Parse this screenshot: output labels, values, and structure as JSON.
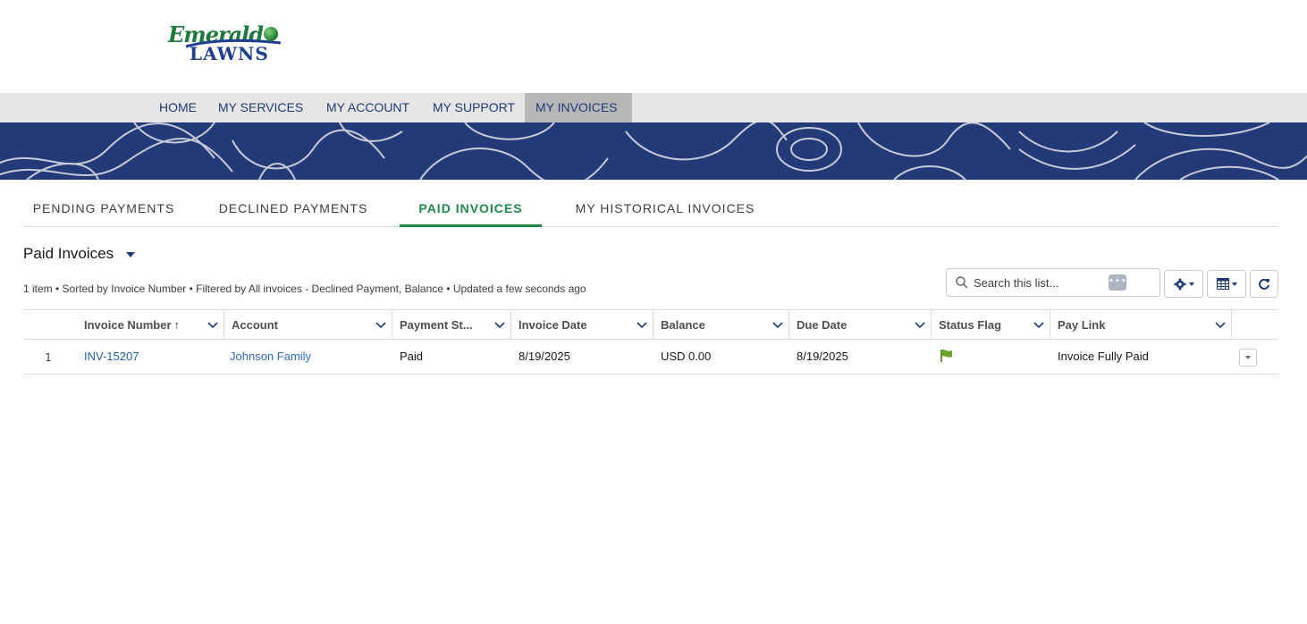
{
  "logo": {
    "script_text": "Emerald",
    "block_text": "LAWNS"
  },
  "nav": {
    "items": [
      {
        "label": "HOME"
      },
      {
        "label": "MY SERVICES"
      },
      {
        "label": "MY ACCOUNT"
      },
      {
        "label": "MY SUPPORT"
      },
      {
        "label": "MY INVOICES",
        "active": true
      }
    ]
  },
  "tabs": [
    {
      "label": "PENDING PAYMENTS"
    },
    {
      "label": "DECLINED PAYMENTS"
    },
    {
      "label": "PAID INVOICES",
      "active": true
    },
    {
      "label": "MY HISTORICAL INVOICES"
    }
  ],
  "list": {
    "title": "Paid Invoices",
    "meta": "1 item • Sorted by Invoice Number • Filtered by All invoices - Declined Payment, Balance • Updated a few seconds ago",
    "search_placeholder": "Search this list...",
    "toolbar_icons": [
      "settings-gear-icon",
      "table-view-icon",
      "refresh-icon"
    ]
  },
  "table": {
    "columns": [
      {
        "label": "Invoice Number",
        "sorted": "ascending"
      },
      {
        "label": "Account"
      },
      {
        "label": "Payment St..."
      },
      {
        "label": "Invoice Date"
      },
      {
        "label": "Balance"
      },
      {
        "label": "Due Date"
      },
      {
        "label": "Status Flag"
      },
      {
        "label": "Pay Link"
      }
    ],
    "rows": [
      {
        "num": "1",
        "invoice_number": "INV-15207",
        "account": "Johnson Family",
        "payment_status": "Paid",
        "invoice_date": "8/19/2025",
        "balance": "USD 0.00",
        "due_date": "8/19/2025",
        "status_flag": "green-flag-icon",
        "pay_link": "Invoice Fully Paid"
      }
    ]
  },
  "colors": {
    "nav_bg": "#e6e6e6",
    "nav_active_bg": "#b7b7b7",
    "banner_bg": "#223a77",
    "tab_active": "#1e8a4a",
    "link": "#1f5ea8",
    "flag": "#6aa622"
  }
}
